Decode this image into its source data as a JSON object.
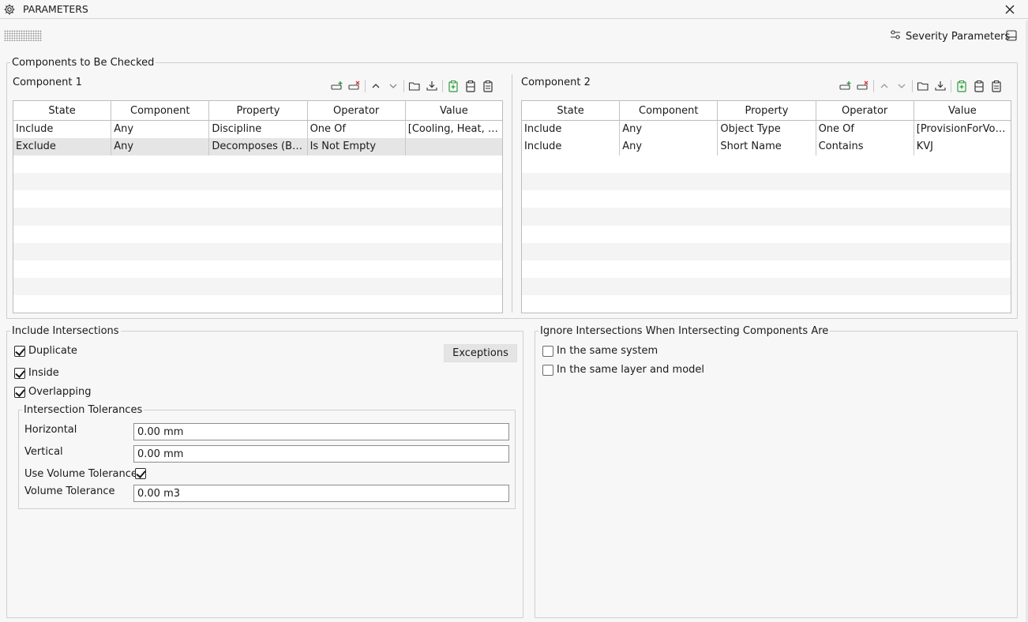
{
  "window": {
    "title": "PARAMETERS",
    "title_icon": "gear-icon",
    "close_icon": "close-icon"
  },
  "toolbar": {
    "severity_label": "Severity Parameters",
    "severity_icon": "sliders-icon",
    "layout_icon": "panel-layout-icon",
    "grip_icon": "drag-grip-icon"
  },
  "components": {
    "group_title": "Components to Be Checked",
    "columns": [
      "State",
      "Component",
      "Property",
      "Operator",
      "Value"
    ],
    "component1": {
      "label": "Component 1",
      "rows": [
        [
          "Include",
          "Any",
          "Discipline",
          "One Of",
          "[Cooling, Heat, Ve..."
        ],
        [
          "Exclude",
          "Any",
          "Decomposes (Back...",
          "Is Not Empty",
          ""
        ]
      ],
      "selected_row": 1
    },
    "component2": {
      "label": "Component 2",
      "rows": [
        [
          "Include",
          "Any",
          "Object Type",
          "One Of",
          "[ProvisionForVoid]"
        ],
        [
          "Include",
          "Any",
          "Short Name",
          "Contains",
          "KVJ"
        ]
      ]
    },
    "tool_icons": [
      "add-row-icon",
      "remove-row-icon",
      "move-up-icon",
      "move-down-icon",
      "open-folder-icon",
      "import-icon",
      "add-clipboard-icon",
      "clipboard-icon",
      "clipboard-list-icon"
    ]
  },
  "include": {
    "group_title": "Include Intersections",
    "options": [
      {
        "label": "Duplicate",
        "checked": true
      },
      {
        "label": "Inside",
        "checked": true
      },
      {
        "label": "Overlapping",
        "checked": true
      }
    ],
    "exceptions_label": "Exceptions",
    "tolerances": {
      "group_title": "Intersection Tolerances",
      "horizontal_label": "Horizontal",
      "horizontal_value": "0.00 mm",
      "vertical_label": "Vertical",
      "vertical_value": "0.00 mm",
      "use_volume_label": "Use Volume Tolerance",
      "use_volume_checked": true,
      "volume_label": "Volume Tolerance",
      "volume_value": "0.00 m3"
    }
  },
  "ignore": {
    "group_title": "Ignore Intersections When Intersecting Components Are",
    "options": [
      {
        "label": "In the same system",
        "checked": false
      },
      {
        "label": "In the same layer and model",
        "checked": false
      }
    ]
  }
}
